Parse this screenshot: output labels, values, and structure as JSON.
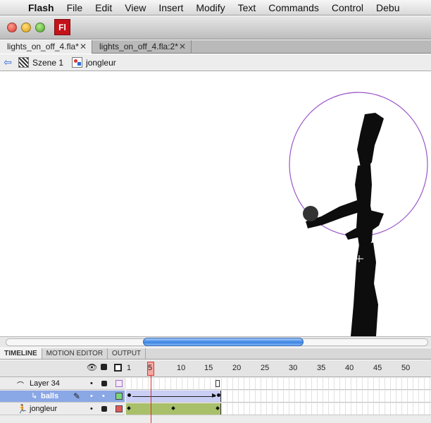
{
  "menubar": {
    "apple": "",
    "items": [
      "Flash",
      "File",
      "Edit",
      "View",
      "Insert",
      "Modify",
      "Text",
      "Commands",
      "Control",
      "Debu"
    ]
  },
  "window": {
    "logo": "Fl",
    "tabs": [
      {
        "label": "lights_on_off_4.fla*",
        "close": "✕"
      },
      {
        "label": "lights_on_off_4.fla:2*",
        "close": "✕"
      }
    ]
  },
  "editbar": {
    "back_icon": "arrow-left-icon",
    "scene": "Szene 1",
    "symbol": "jongleur"
  },
  "panel_tabs": [
    "TIMELINE",
    "MOTION EDITOR",
    "OUTPUT"
  ],
  "timeline": {
    "ruler": [
      "1",
      "5",
      "10",
      "15",
      "20",
      "25",
      "30",
      "35",
      "40",
      "45",
      "50"
    ],
    "playhead_frame": 5,
    "layers": [
      {
        "name": "Layer 34",
        "color": "#c48fe0"
      },
      {
        "name": "balls",
        "color": "#7cd67c"
      },
      {
        "name": "jongleur",
        "color": "#e05a5a"
      }
    ]
  },
  "colors": {
    "tween_fill": "#c9cef5",
    "shape_fill": "#a9c06b",
    "selected_row": "#8aa7e6",
    "guide_circle": "#9a55c9"
  }
}
